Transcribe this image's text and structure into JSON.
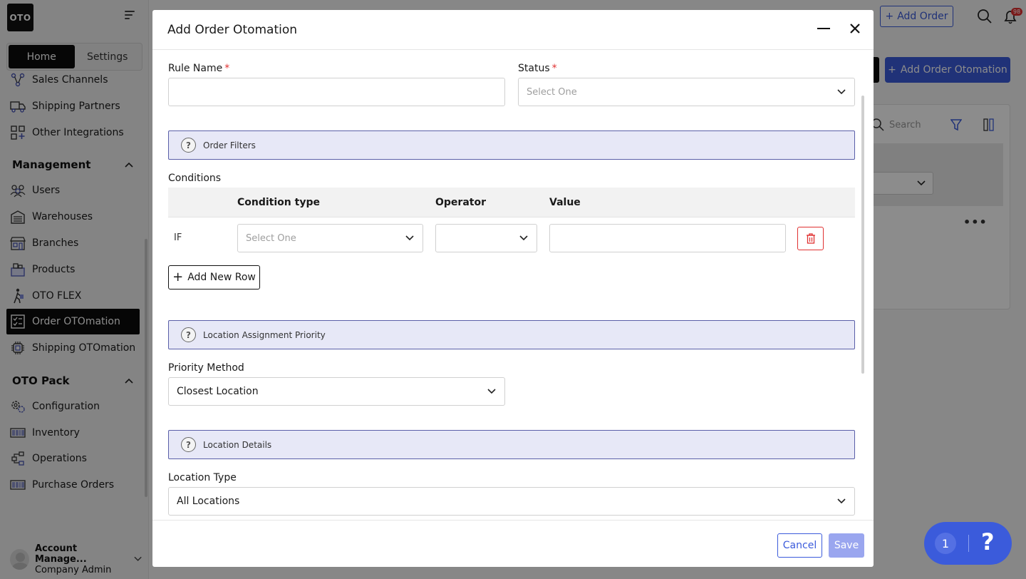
{
  "sidebar": {
    "logo": "OTO",
    "tabs": [
      {
        "label": "Home"
      },
      {
        "label": "Settings"
      }
    ],
    "items": [
      {
        "label": "Sales Channels",
        "icon": "sales-channels-icon"
      },
      {
        "label": "Shipping Partners",
        "icon": "truck-icon"
      },
      {
        "label": "Other Integrations",
        "icon": "grid-icon"
      },
      {
        "label": "Users",
        "icon": "users-icon"
      },
      {
        "label": "Warehouses",
        "icon": "warehouse-icon"
      },
      {
        "label": "Branches",
        "icon": "store-icon"
      },
      {
        "label": "Products",
        "icon": "box-icon"
      },
      {
        "label": "OTO FLEX",
        "icon": "courier-icon"
      },
      {
        "label": "Order OTOmation",
        "icon": "order-automation-icon"
      },
      {
        "label": "Shipping OTOmation",
        "icon": "cpu-icon"
      },
      {
        "label": "Configuration",
        "icon": "gears-icon"
      },
      {
        "label": "Inventory",
        "icon": "barcode-icon"
      },
      {
        "label": "Operations",
        "icon": "flow-icon"
      },
      {
        "label": "Purchase Orders",
        "icon": "barcode-icon"
      }
    ],
    "sections": [
      {
        "label": "Management"
      },
      {
        "label": "OTO Pack"
      }
    ],
    "account": {
      "name": "Account Manage...",
      "role": "Company Admin"
    }
  },
  "topbar": {
    "add_order": "Add Order",
    "notifications": "98"
  },
  "page": {
    "add_automation": "Add Order Otomation",
    "search_placeholder": "Search"
  },
  "modal": {
    "title": "Add Order Otomation",
    "rule_name_label": "Rule Name",
    "status_label": "Status",
    "required_mark": "*",
    "status_placeholder": "Select One",
    "order_filters_banner": "Order Filters",
    "conditions_label": "Conditions",
    "columns": {
      "condition_type": "Condition type",
      "operator": "Operator",
      "value": "Value"
    },
    "row": {
      "if_label": "IF",
      "condition_placeholder": "Select One"
    },
    "add_row": "Add New Row",
    "location_priority_banner": "Location Assignment Priority",
    "priority_method_label": "Priority Method",
    "priority_method_value": "Closest Location",
    "location_details_banner": "Location Details",
    "location_type_label": "Location Type",
    "location_type_value": "All Locations",
    "cancel": "Cancel",
    "save": "Save"
  },
  "help_widget": {
    "count": "1",
    "symbol": "?"
  },
  "colors": {
    "accent": "#3b5bdb",
    "danger": "#e03131",
    "banner_bg": "#e7e8f7",
    "banner_border": "#5a5fa8"
  }
}
